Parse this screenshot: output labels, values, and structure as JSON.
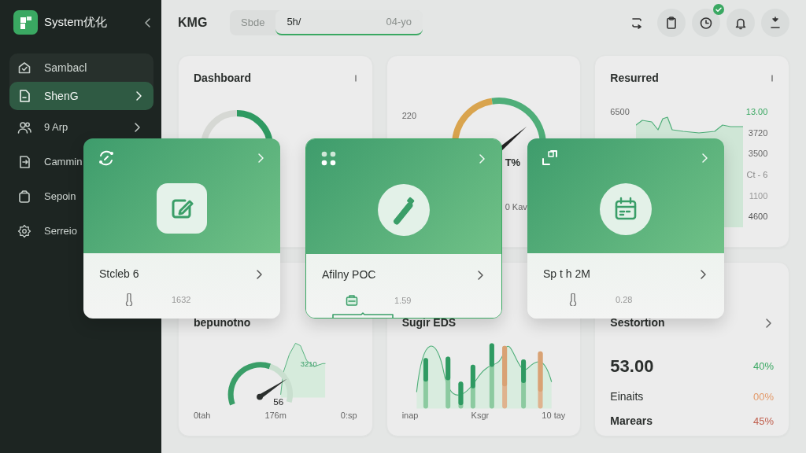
{
  "sidebar": {
    "title": "System优化",
    "items": [
      {
        "label": "Sambacl",
        "selected": false,
        "has_submenu": false
      },
      {
        "label": "ShenG",
        "selected": true,
        "has_submenu": true
      },
      {
        "label": "9 Arp",
        "selected": false,
        "has_submenu": true
      },
      {
        "label": "Cammin",
        "selected": false,
        "has_submenu": false
      },
      {
        "label": "Sepoin",
        "selected": false,
        "has_submenu": false
      },
      {
        "label": "Serreio",
        "selected": false,
        "has_submenu": false
      }
    ]
  },
  "topbar": {
    "title": "KMG",
    "tabs": [
      {
        "label": "Sbde",
        "selected": false
      },
      {
        "label": "5h/",
        "selected": true
      }
    ],
    "range": "04-yo",
    "badge_checked": true
  },
  "cards": [
    {
      "kind": "gauge",
      "title": "Dashboard"
    },
    {
      "kind": "dial",
      "reading": "220",
      "labels": [
        "T%",
        "0 Kav"
      ]
    },
    {
      "kind": "area",
      "title": "Resurred",
      "axis_label": "6500",
      "labels": [
        {
          "text": "13.00",
          "color": "#3aa862"
        },
        {
          "text": "3720",
          "color": "#666666"
        },
        {
          "text": "3500",
          "color": "#666666"
        },
        {
          "text": "Ct - 6",
          "color": "#888888"
        },
        {
          "text": "1100",
          "color": "#999999"
        },
        {
          "text": "4600",
          "color": "#555555"
        }
      ]
    },
    {
      "kind": "combo",
      "title": "bepunotno",
      "peak": "3210",
      "reading": "56",
      "axis": [
        "0tah",
        "176m",
        "0:sp"
      ]
    },
    {
      "kind": "bars",
      "title": "Sugir EDS",
      "axis": [
        "inap",
        "Ksgr",
        "10 tay"
      ]
    },
    {
      "kind": "stats",
      "title": "Sestortion",
      "rows": [
        {
          "kind": "total",
          "label": "53.00",
          "value": "40%",
          "color": "#3aa862"
        },
        {
          "kind": "item",
          "label": "Einaits",
          "value": "00%",
          "color": "#e39a6a"
        },
        {
          "kind": "item",
          "label": "Marears",
          "value": "45%",
          "color": "#c0604f"
        }
      ]
    }
  ],
  "floating_cards": [
    {
      "kind": "edit",
      "title": "Stcleb 6",
      "value": "1632",
      "selected": false
    },
    {
      "kind": "marker",
      "title": "Afilny POC",
      "value": "1.59",
      "selected": true
    },
    {
      "kind": "calendar",
      "title": "Sp t h 2M",
      "value": "0.28",
      "selected": false
    }
  ]
}
